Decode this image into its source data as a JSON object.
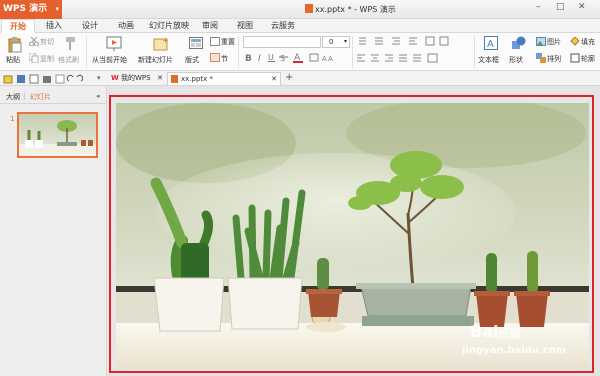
{
  "titlebar": {
    "app_name": "WPS 演示",
    "document_title": "xx.pptx * - WPS 演示"
  },
  "ribbon_tabs": [
    "开始",
    "插入",
    "设计",
    "动画",
    "幻灯片放映",
    "审阅",
    "视图",
    "云服务"
  ],
  "ribbon": {
    "paste": "粘贴",
    "cut": "剪切",
    "copy": "复制",
    "format_painter": "格式刷",
    "from_current": "从当前开始",
    "new_slide": "新建幻灯片",
    "layout": "版式",
    "reset": "重置",
    "section": "节",
    "font_size": "0",
    "textbox": "文本框",
    "shape": "形状",
    "picture": "图片",
    "fill": "填充",
    "arrange": "排列",
    "outline": "轮廓"
  },
  "doc_tabs": [
    "我的WPS",
    "xx.pptx *"
  ],
  "sidebar": {
    "tabs": [
      "大纲",
      "幻灯片"
    ],
    "slide_number": "1"
  },
  "watermark": {
    "brand": "Bai",
    "brand_cn": "经验",
    "url": "jingyan.baidu.com"
  },
  "colors": {
    "accent": "#e26a2c",
    "wps_logo": "#e5602c",
    "selection_border": "#e0222a"
  },
  "icons": [
    "paste-icon",
    "cut-icon",
    "copy-icon",
    "format-painter-icon",
    "play-icon",
    "new-slide-icon",
    "layout-icon",
    "reset-icon",
    "section-icon",
    "bold-icon",
    "italic-icon",
    "underline-icon",
    "textbox-icon",
    "shape-icon",
    "picture-icon",
    "fill-icon",
    "arrange-icon",
    "outline-icon",
    "open-icon",
    "save-icon",
    "print-icon",
    "undo-icon",
    "redo-icon",
    "add-tab-icon"
  ]
}
